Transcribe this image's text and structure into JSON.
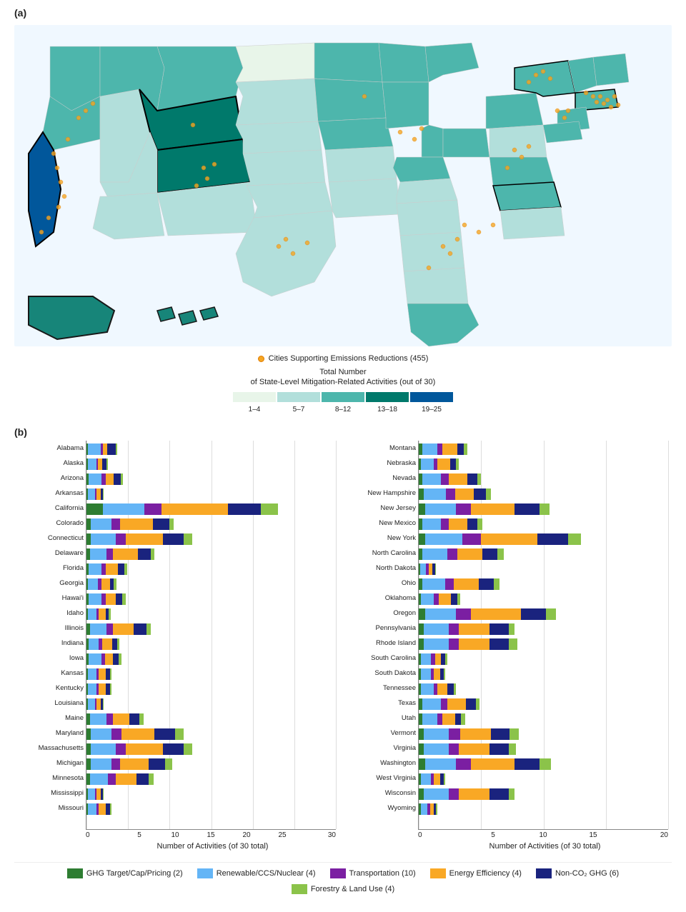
{
  "section_a_label": "(a)",
  "section_b_label": "(b)",
  "cities_legend": "Cities Supporting Emissions Reductions (455)",
  "map_legend_title": "Total Number\nof State-Level Mitigation-Related Activities (out of 30)",
  "color_scale": {
    "ranges": [
      "1–4",
      "5–7",
      "8–12",
      "13–18",
      "19–25"
    ],
    "colors": [
      "#e8f5e9",
      "#b2dfdb",
      "#4db6ac",
      "#00796b",
      "#01579b"
    ]
  },
  "x_axis_left": [
    "0",
    "5",
    "10",
    "15",
    "20",
    "25",
    "30"
  ],
  "x_axis_right": [
    "0",
    "5",
    "10",
    "15",
    "20"
  ],
  "x_axis_title": "Number of Activities (of 30 total)",
  "legend_items": [
    {
      "label": "GHG Target/Cap/Pricing (2)",
      "color": "#2e7d32"
    },
    {
      "label": "Renewable/CCS/Nuclear (4)",
      "color": "#64b5f6"
    },
    {
      "label": "Transportation (10)",
      "color": "#7b1fa2"
    },
    {
      "label": "Energy Efficiency (4)",
      "color": "#f9a825"
    },
    {
      "label": "Non-CO₂ GHG (6)",
      "color": "#1a237e"
    },
    {
      "label": "Forestry & Land Use (4)",
      "color": "#8bc34a"
    }
  ],
  "left_states": [
    {
      "name": "Alabama",
      "bars": [
        0.2,
        1.5,
        0.3,
        0.5,
        1.0,
        0.2
      ]
    },
    {
      "name": "Alaska",
      "bars": [
        0.2,
        1.0,
        0.2,
        0.5,
        0.5,
        0.2
      ]
    },
    {
      "name": "Arizona",
      "bars": [
        0.3,
        1.5,
        0.5,
        1.0,
        0.8,
        0.3
      ]
    },
    {
      "name": "Arkansas",
      "bars": [
        0.2,
        0.8,
        0.2,
        0.5,
        0.3,
        0.1
      ]
    },
    {
      "name": "California",
      "bars": [
        2.0,
        5.0,
        2.0,
        8.0,
        4.0,
        2.0
      ]
    },
    {
      "name": "Colorado",
      "bars": [
        0.5,
        2.5,
        1.0,
        4.0,
        2.0,
        0.5
      ]
    },
    {
      "name": "Connecticut",
      "bars": [
        0.5,
        3.0,
        1.2,
        4.5,
        2.5,
        1.0
      ]
    },
    {
      "name": "Delaware",
      "bars": [
        0.4,
        2.0,
        0.8,
        3.0,
        1.5,
        0.5
      ]
    },
    {
      "name": "Florida",
      "bars": [
        0.3,
        1.5,
        0.5,
        1.5,
        0.8,
        0.3
      ]
    },
    {
      "name": "Georgia",
      "bars": [
        0.2,
        1.2,
        0.4,
        1.0,
        0.5,
        0.3
      ]
    },
    {
      "name": "Hawai'i",
      "bars": [
        0.3,
        1.5,
        0.5,
        1.2,
        0.8,
        0.4
      ]
    },
    {
      "name": "Idaho",
      "bars": [
        0.2,
        1.0,
        0.3,
        0.8,
        0.4,
        0.2
      ]
    },
    {
      "name": "Illinois",
      "bars": [
        0.4,
        2.0,
        0.8,
        2.5,
        1.5,
        0.5
      ]
    },
    {
      "name": "Indiana",
      "bars": [
        0.3,
        1.2,
        0.4,
        1.2,
        0.6,
        0.3
      ]
    },
    {
      "name": "Iowa",
      "bars": [
        0.3,
        1.5,
        0.4,
        1.0,
        0.7,
        0.3
      ]
    },
    {
      "name": "Kansas",
      "bars": [
        0.2,
        1.0,
        0.3,
        0.8,
        0.5,
        0.2
      ]
    },
    {
      "name": "Kentucky",
      "bars": [
        0.2,
        1.0,
        0.3,
        0.8,
        0.5,
        0.2
      ]
    },
    {
      "name": "Louisiana",
      "bars": [
        0.2,
        0.8,
        0.2,
        0.5,
        0.3,
        0.1
      ]
    },
    {
      "name": "Maine",
      "bars": [
        0.4,
        2.0,
        0.8,
        2.0,
        1.2,
        0.5
      ]
    },
    {
      "name": "Maryland",
      "bars": [
        0.5,
        2.5,
        1.2,
        4.0,
        2.5,
        1.0
      ]
    },
    {
      "name": "Massachusetts",
      "bars": [
        0.5,
        3.0,
        1.2,
        4.5,
        2.5,
        1.0
      ]
    },
    {
      "name": "Michigan",
      "bars": [
        0.5,
        2.5,
        1.0,
        3.5,
        2.0,
        0.8
      ]
    },
    {
      "name": "Minnesota",
      "bars": [
        0.4,
        2.2,
        0.9,
        2.5,
        1.5,
        0.6
      ]
    },
    {
      "name": "Mississippi",
      "bars": [
        0.2,
        0.8,
        0.2,
        0.5,
        0.3,
        0.1
      ]
    },
    {
      "name": "Missouri",
      "bars": [
        0.2,
        1.0,
        0.3,
        0.8,
        0.5,
        0.2
      ]
    }
  ],
  "right_states": [
    {
      "name": "Montana",
      "bars": [
        0.3,
        1.2,
        0.4,
        1.2,
        0.5,
        0.3
      ]
    },
    {
      "name": "Nebraska",
      "bars": [
        0.2,
        1.0,
        0.3,
        1.0,
        0.5,
        0.2
      ]
    },
    {
      "name": "Nevada",
      "bars": [
        0.3,
        1.5,
        0.6,
        1.5,
        0.8,
        0.3
      ]
    },
    {
      "name": "New Hampshire",
      "bars": [
        0.4,
        1.8,
        0.7,
        1.5,
        1.0,
        0.4
      ]
    },
    {
      "name": "New Jersey",
      "bars": [
        0.5,
        2.5,
        1.2,
        3.5,
        2.0,
        0.8
      ]
    },
    {
      "name": "New Mexico",
      "bars": [
        0.3,
        1.5,
        0.6,
        1.5,
        0.8,
        0.4
      ]
    },
    {
      "name": "New York",
      "bars": [
        0.5,
        3.0,
        1.5,
        4.5,
        2.5,
        1.0
      ]
    },
    {
      "name": "North Carolina",
      "bars": [
        0.3,
        2.0,
        0.8,
        2.0,
        1.2,
        0.5
      ]
    },
    {
      "name": "North Dakota",
      "bars": [
        0.1,
        0.5,
        0.2,
        0.3,
        0.2,
        0.1
      ]
    },
    {
      "name": "Ohio",
      "bars": [
        0.3,
        1.8,
        0.7,
        2.0,
        1.2,
        0.5
      ]
    },
    {
      "name": "Oklahoma",
      "bars": [
        0.2,
        1.0,
        0.4,
        1.0,
        0.5,
        0.2
      ]
    },
    {
      "name": "Oregon",
      "bars": [
        0.5,
        2.5,
        1.2,
        4.0,
        2.0,
        0.8
      ]
    },
    {
      "name": "Pennsylvania",
      "bars": [
        0.4,
        2.0,
        0.8,
        2.5,
        1.5,
        0.5
      ]
    },
    {
      "name": "Rhode Island",
      "bars": [
        0.4,
        2.0,
        0.8,
        2.5,
        1.5,
        0.7
      ]
    },
    {
      "name": "South Carolina",
      "bars": [
        0.2,
        0.8,
        0.3,
        0.5,
        0.3,
        0.2
      ]
    },
    {
      "name": "South Dakota",
      "bars": [
        0.2,
        0.8,
        0.2,
        0.5,
        0.3,
        0.1
      ]
    },
    {
      "name": "Tennessee",
      "bars": [
        0.2,
        1.0,
        0.3,
        0.8,
        0.5,
        0.2
      ]
    },
    {
      "name": "Texas",
      "bars": [
        0.3,
        1.5,
        0.5,
        1.5,
        0.8,
        0.3
      ]
    },
    {
      "name": "Utah",
      "bars": [
        0.3,
        1.2,
        0.4,
        1.0,
        0.5,
        0.3
      ]
    },
    {
      "name": "Vermont",
      "bars": [
        0.4,
        2.0,
        0.9,
        2.5,
        1.5,
        0.7
      ]
    },
    {
      "name": "Virginia",
      "bars": [
        0.4,
        2.0,
        0.8,
        2.5,
        1.5,
        0.6
      ]
    },
    {
      "name": "Washington",
      "bars": [
        0.5,
        2.5,
        1.2,
        3.5,
        2.0,
        0.9
      ]
    },
    {
      "name": "West Virginia",
      "bars": [
        0.2,
        0.8,
        0.2,
        0.5,
        0.3,
        0.1
      ]
    },
    {
      "name": "Wisconsin",
      "bars": [
        0.4,
        2.0,
        0.8,
        2.5,
        1.5,
        0.5
      ]
    },
    {
      "name": "Wyoming",
      "bars": [
        0.2,
        0.5,
        0.2,
        0.3,
        0.2,
        0.1
      ]
    }
  ],
  "bar_colors": [
    "#2e7d32",
    "#64b5f6",
    "#7b1fa2",
    "#f9a825",
    "#1a237e",
    "#8bc34a"
  ],
  "left_max": 30,
  "right_max": 20
}
